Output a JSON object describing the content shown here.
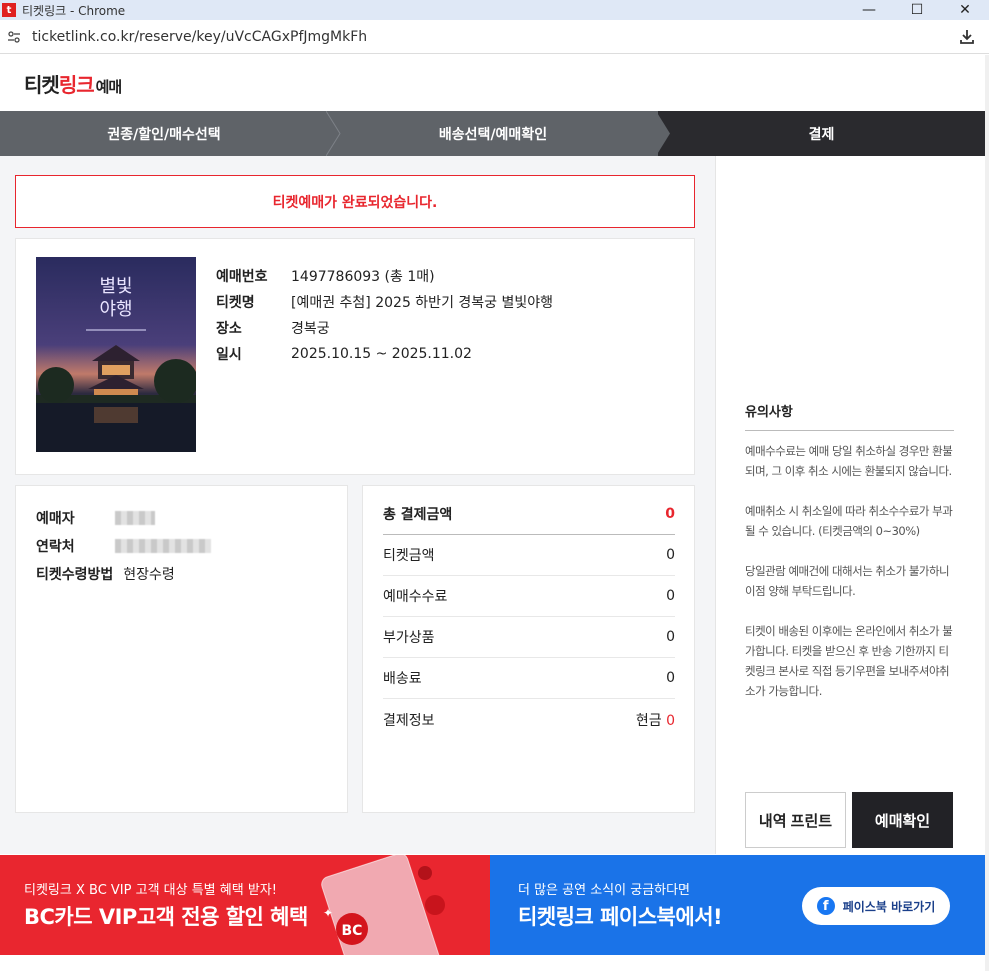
{
  "window": {
    "title": "티켓링크 - Chrome",
    "app_icon": "t",
    "minimize": "—",
    "maximize": "☐",
    "close": "✕"
  },
  "address": {
    "url": "ticketlink.co.kr/reserve/key/uVcCAGxPfJmgMkFh"
  },
  "logo": {
    "part1": "티켓",
    "part2": "링크",
    "part3": "예매"
  },
  "steps": {
    "step1": "권종/할인/매수선택",
    "step2": "배송선택/예매확인",
    "step3": "결제"
  },
  "complete_message": "티켓예매가 완료되었습니다.",
  "booking": {
    "rows": [
      {
        "label": "예매번호",
        "value": "1497786093 (총 1매)"
      },
      {
        "label": "티켓명",
        "value": "[예매권 추첨] 2025 하반기 경복궁 별빛야행"
      },
      {
        "label": "장소",
        "value": "경복궁"
      },
      {
        "label": "일시",
        "value": "2025.10.15 ~ 2025.11.02"
      }
    ]
  },
  "buyer": {
    "name_label": "예매자",
    "contact_label": "연락처",
    "receive_label": "티켓수령방법",
    "receive_value": "현장수령"
  },
  "payment": {
    "total_label": "총 결제금액",
    "total_value": "0",
    "rows": [
      {
        "label": "티켓금액",
        "value": "0"
      },
      {
        "label": "예매수수료",
        "value": "0"
      },
      {
        "label": "부가상품",
        "value": "0"
      },
      {
        "label": "배송료",
        "value": "0"
      }
    ],
    "method_label": "결제정보",
    "method_value": "현금",
    "method_amount": "0"
  },
  "notice": {
    "title": "유의사항",
    "p1": "예매수수료는 예매 당일 취소하실 경우만 환불되며, 그 이후 취소 시에는 환불되지 않습니다.",
    "p2": "예매취소 시 취소일에 따라 취소수수료가 부과될 수 있습니다. (티켓금액의 0~30%)",
    "p3": "당일관람 예매건에 대해서는 취소가 불가하니 이점 양해 부탁드립니다.",
    "p4": "티켓이 배송된 이후에는 온라인에서 취소가 불가합니다. 티켓을 받으신 후 반송 기한까지 티켓링크 본사로 직접 등기우편을 보내주셔야취소가 가능합니다."
  },
  "buttons": {
    "print": "내역 프린트",
    "confirm": "예매확인"
  },
  "banner_bc": {
    "small": "티켓링크 X BC VIP 고객 대상 특별 혜택 받자!",
    "big": "BC카드 VIP고객 전용 할인 혜택"
  },
  "banner_fb": {
    "small": "더 많은 공연 소식이 궁금하다면",
    "big": "티켓링크 페이스북에서!",
    "button": "페이스북 바로가기"
  },
  "colors": {
    "accent_red": "#e8262e",
    "step_active": "#2a2a2e",
    "step_inactive": "#5f6368",
    "facebook_blue": "#1a73e8"
  }
}
